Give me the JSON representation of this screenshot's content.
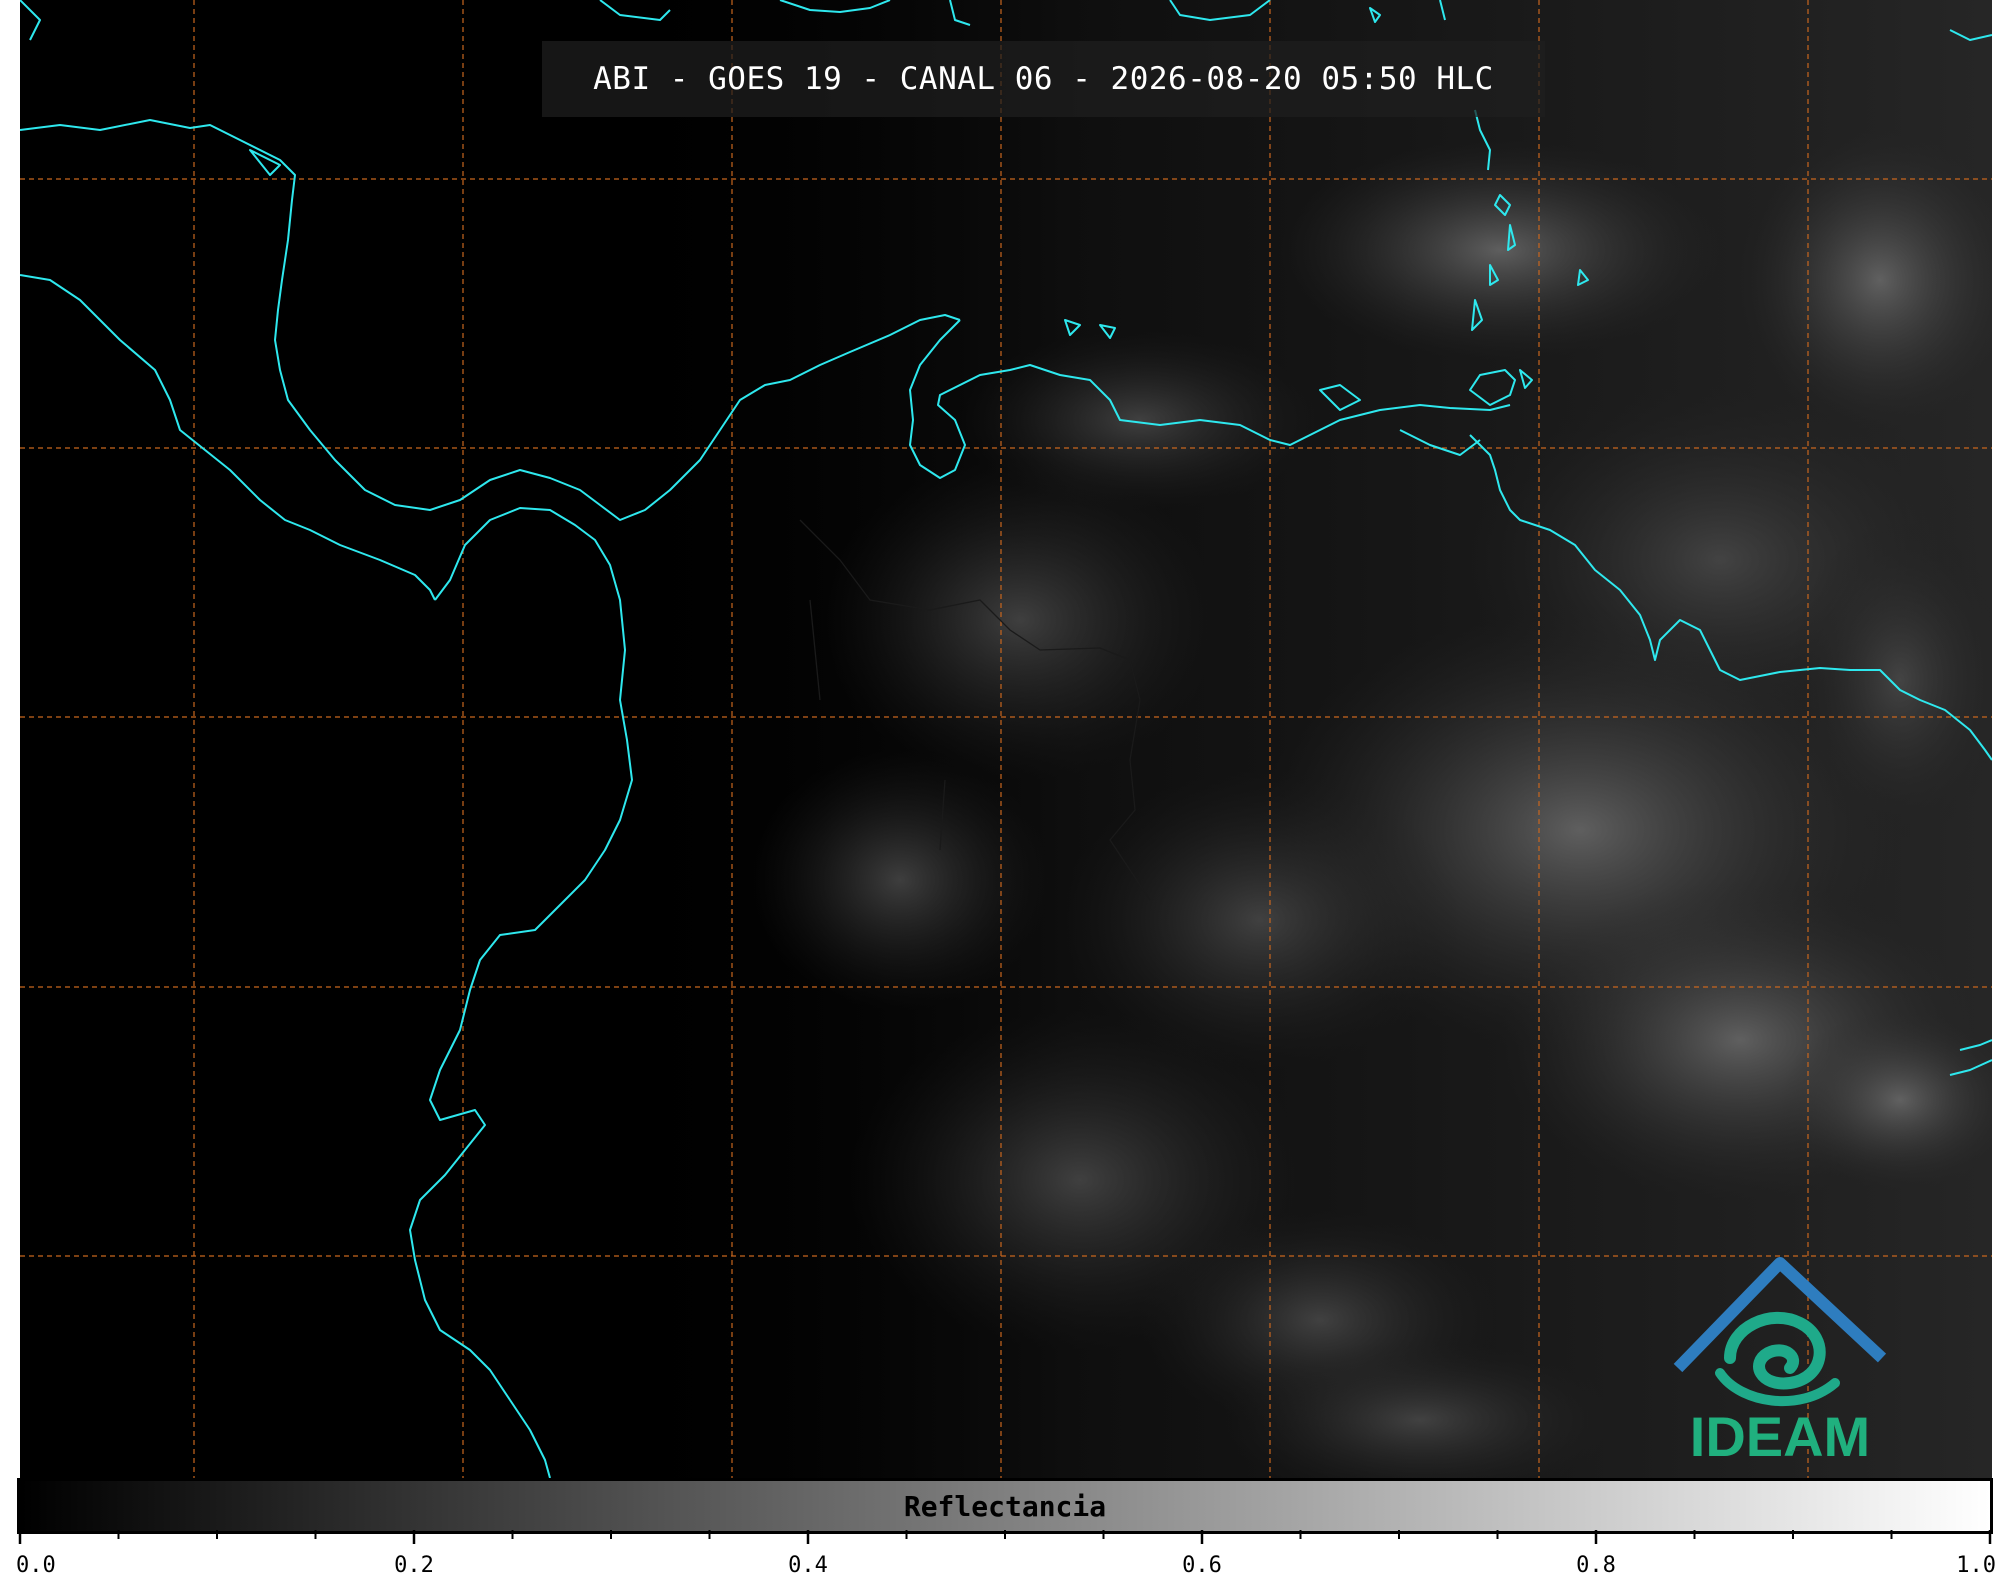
{
  "title": "ABI - GOES 19 - CANAL 06 - 2026-08-20 05:50 HLC",
  "map": {
    "coastline_color": "#2ee8ee",
    "border_color": "#1a1a1a",
    "gridline_color": "#c8661e",
    "background_color": "#000000"
  },
  "colorbar": {
    "label": "Reflectancia",
    "range": [
      0.0,
      1.0
    ],
    "colormap": "gray",
    "tick_labels": [
      "0.0",
      "0.2",
      "0.4",
      "0.6",
      "0.8",
      "1.0"
    ],
    "tick_values": [
      0.0,
      0.2,
      0.4,
      0.6,
      0.8,
      1.0
    ],
    "minor_tick_step": 0.05
  },
  "logo": {
    "text": "IDEAM",
    "text_color": "#20b07e",
    "mountain_color": "#2e7dbf",
    "spiral_color": "#1faa8a",
    "icon": "ideam-logo-icon"
  }
}
